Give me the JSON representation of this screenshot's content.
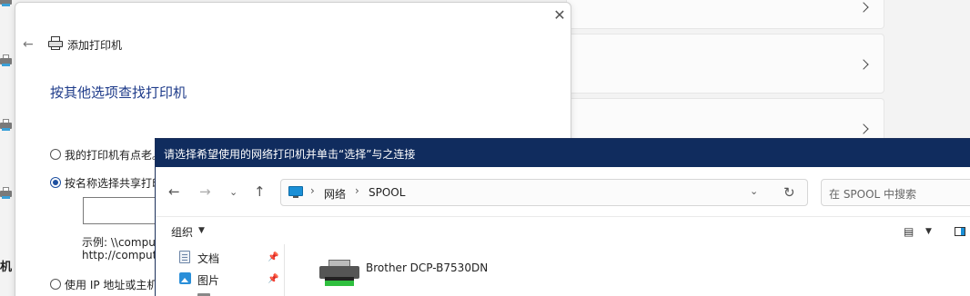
{
  "wizard": {
    "title": "添加打印机",
    "heading": "按其他选项查找打印机",
    "close_glyph": "✕",
    "back_glyph": "←",
    "options": [
      {
        "label": "我的打印机有点老。",
        "checked": false
      },
      {
        "label": "按名称选择共享打印",
        "checked": true
      },
      {
        "label": "使用 IP 地址或主机",
        "checked": false
      }
    ],
    "example_line1": "示例: \\\\compu",
    "example_line2": "http://comput"
  },
  "background": {
    "partial_text": "机"
  },
  "browser": {
    "title": "请选择希望使用的网络打印机并单击“选择”与之连接",
    "breadcrumb": [
      "网络",
      "SPOOL"
    ],
    "search_placeholder": "在 SPOOL 中搜索",
    "organize_label": "组织",
    "nav_items": [
      {
        "label": "文档",
        "icon": "document-icon",
        "pinned": true
      },
      {
        "label": "图片",
        "icon": "pictures-icon",
        "pinned": true
      }
    ],
    "printers": [
      {
        "name": "Brother DCP-B7530DN"
      }
    ]
  }
}
